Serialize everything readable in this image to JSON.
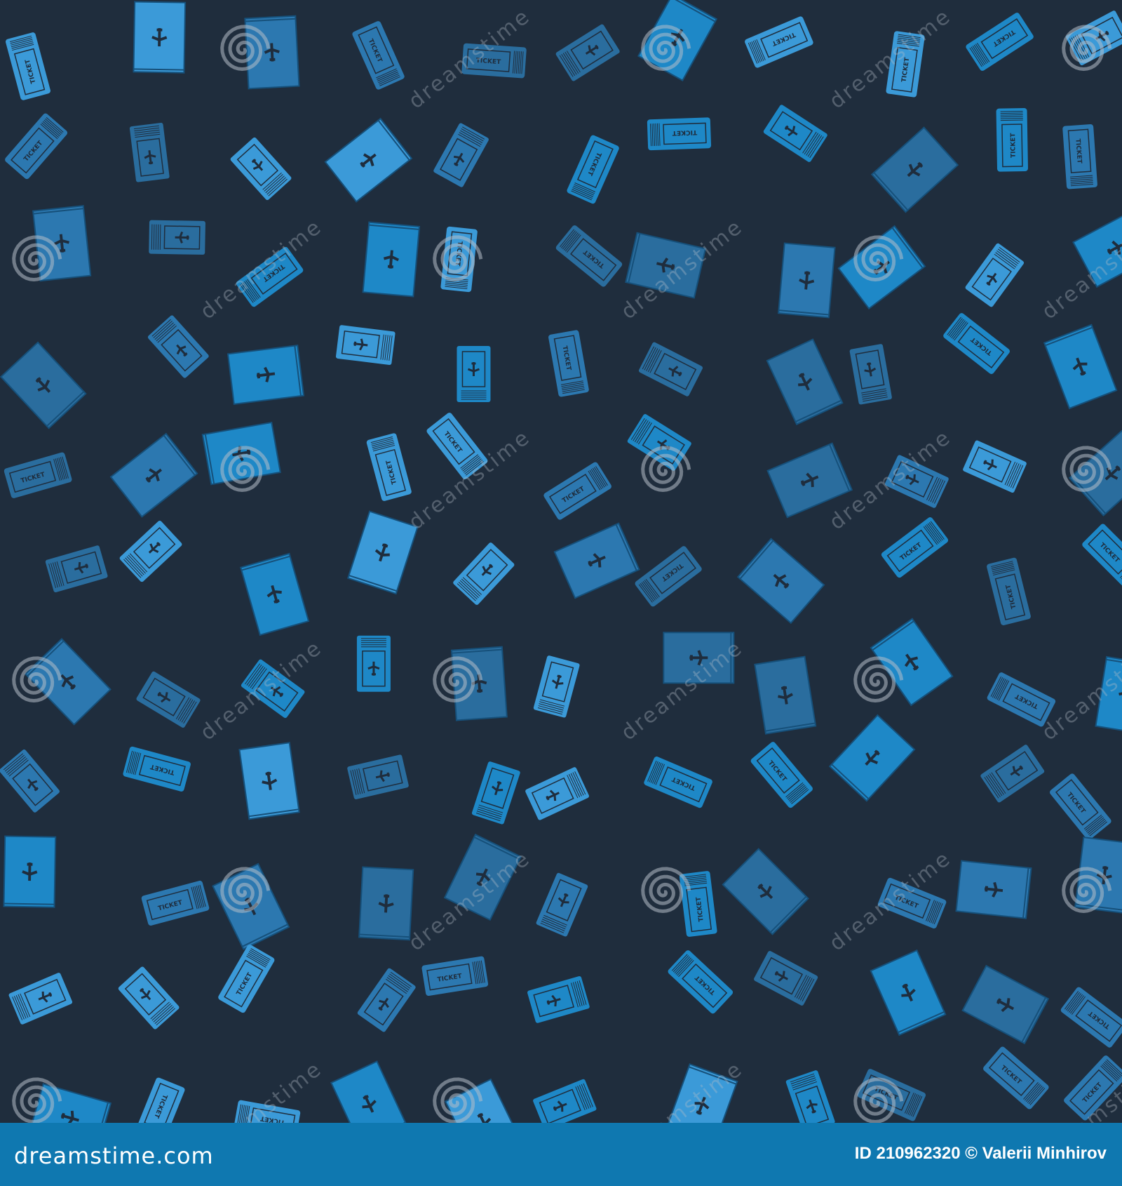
{
  "pattern": {
    "background_color": "#1f2d3d",
    "icon_colors": [
      "#1e88c7",
      "#2c78b0",
      "#3b9ad8",
      "#2a6d9e"
    ],
    "icons": [
      "airline-ticket-icon",
      "boarding-pass-icon",
      "passport-icon"
    ],
    "icon_label": "TICKET"
  },
  "watermark": {
    "text": "dreamstime",
    "icon": "spiral-logo-icon"
  },
  "footer": {
    "background_color": "#0f78b0",
    "logo": "dreamstime.com",
    "credit": "ID 210962320 © Valerii Minhirov"
  }
}
